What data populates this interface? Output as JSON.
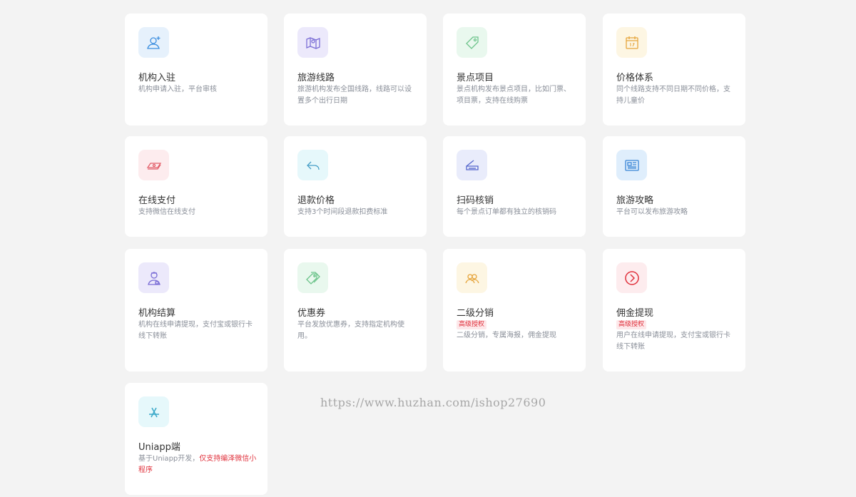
{
  "cards": [
    {
      "title": "机构入驻",
      "desc": "机构申请入驻，平台审核",
      "icon": "user-plus-icon",
      "icon_bg": "#e6f1fc",
      "icon_color": "#3d8fe0"
    },
    {
      "title": "旅游线路",
      "desc": "旅游机构发布全国线路，线路可以设置多个出行日期",
      "icon": "map-icon",
      "icon_bg": "#ece9fb",
      "icon_color": "#7c6fd6"
    },
    {
      "title": "景点项目",
      "desc": "景点机构发布景点项目，比如门票、项目票，支持在线购票",
      "icon": "tag-icon",
      "icon_bg": "#e9f8ee",
      "icon_color": "#6cc38a"
    },
    {
      "title": "价格体系",
      "desc": "同个线路支持不同日期不同价格，支持儿童价",
      "icon": "calendar-icon",
      "icon_bg": "#fdf6e3",
      "icon_color": "#e6a53c"
    },
    {
      "title": "在线支付",
      "desc": "支持微信在线支付",
      "icon": "money-icon",
      "icon_bg": "#fdecee",
      "icon_color": "#e3606b"
    },
    {
      "title": "退款价格",
      "desc": "支持3个时间段退款扣费标准",
      "icon": "reply-icon",
      "icon_bg": "#e6f8fb",
      "icon_color": "#4aa0c8"
    },
    {
      "title": "扫码核销",
      "desc": "每个景点订单都有独立的核销码",
      "icon": "scanner-icon",
      "icon_bg": "#e9ecfb",
      "icon_color": "#5566cc"
    },
    {
      "title": "旅游攻略",
      "desc": "平台可以发布旅游攻略",
      "icon": "newspaper-icon",
      "icon_bg": "#dfeefc",
      "icon_color": "#3a86d6"
    },
    {
      "title": "机构结算",
      "desc": "机构在线申请提现，支付宝或银行卡线下转账",
      "icon": "agent-icon",
      "icon_bg": "#ece9fb",
      "icon_color": "#7c6fd6"
    },
    {
      "title": "优惠券",
      "desc": "平台发放优惠券，支持指定机构使用。",
      "icon": "coupon-tags-icon",
      "icon_bg": "#e9f8ee",
      "icon_color": "#6cc38a"
    },
    {
      "title": "二级分销",
      "badge": "高级授权",
      "desc": "二级分销，专属海报，佣金提现",
      "icon": "users-icon",
      "icon_bg": "#fdf6e3",
      "icon_color": "#e6a53c"
    },
    {
      "title": "佣金提现",
      "badge": "高级授权",
      "desc": "用户在线申请提现，支付宝或银行卡线下转账",
      "icon": "arrow-circle-icon",
      "icon_bg": "#fdecee",
      "icon_color": "#e0313c"
    },
    {
      "title": "Uniapp端",
      "desc_prefix": "基于Uniapp开发，",
      "desc_highlight": "仅支持编泽微信小程序",
      "icon": "appstore-icon",
      "icon_bg": "#e6f8fb",
      "icon_color": "#3aa8c8"
    }
  ],
  "watermark": "https://www.huzhan.com/ishop27690",
  "colors": {
    "page_bg": "#f3f3f3",
    "card_bg": "#ffffff",
    "title": "#333333",
    "desc": "#8a8f99",
    "accent_red": "#e0313c"
  }
}
